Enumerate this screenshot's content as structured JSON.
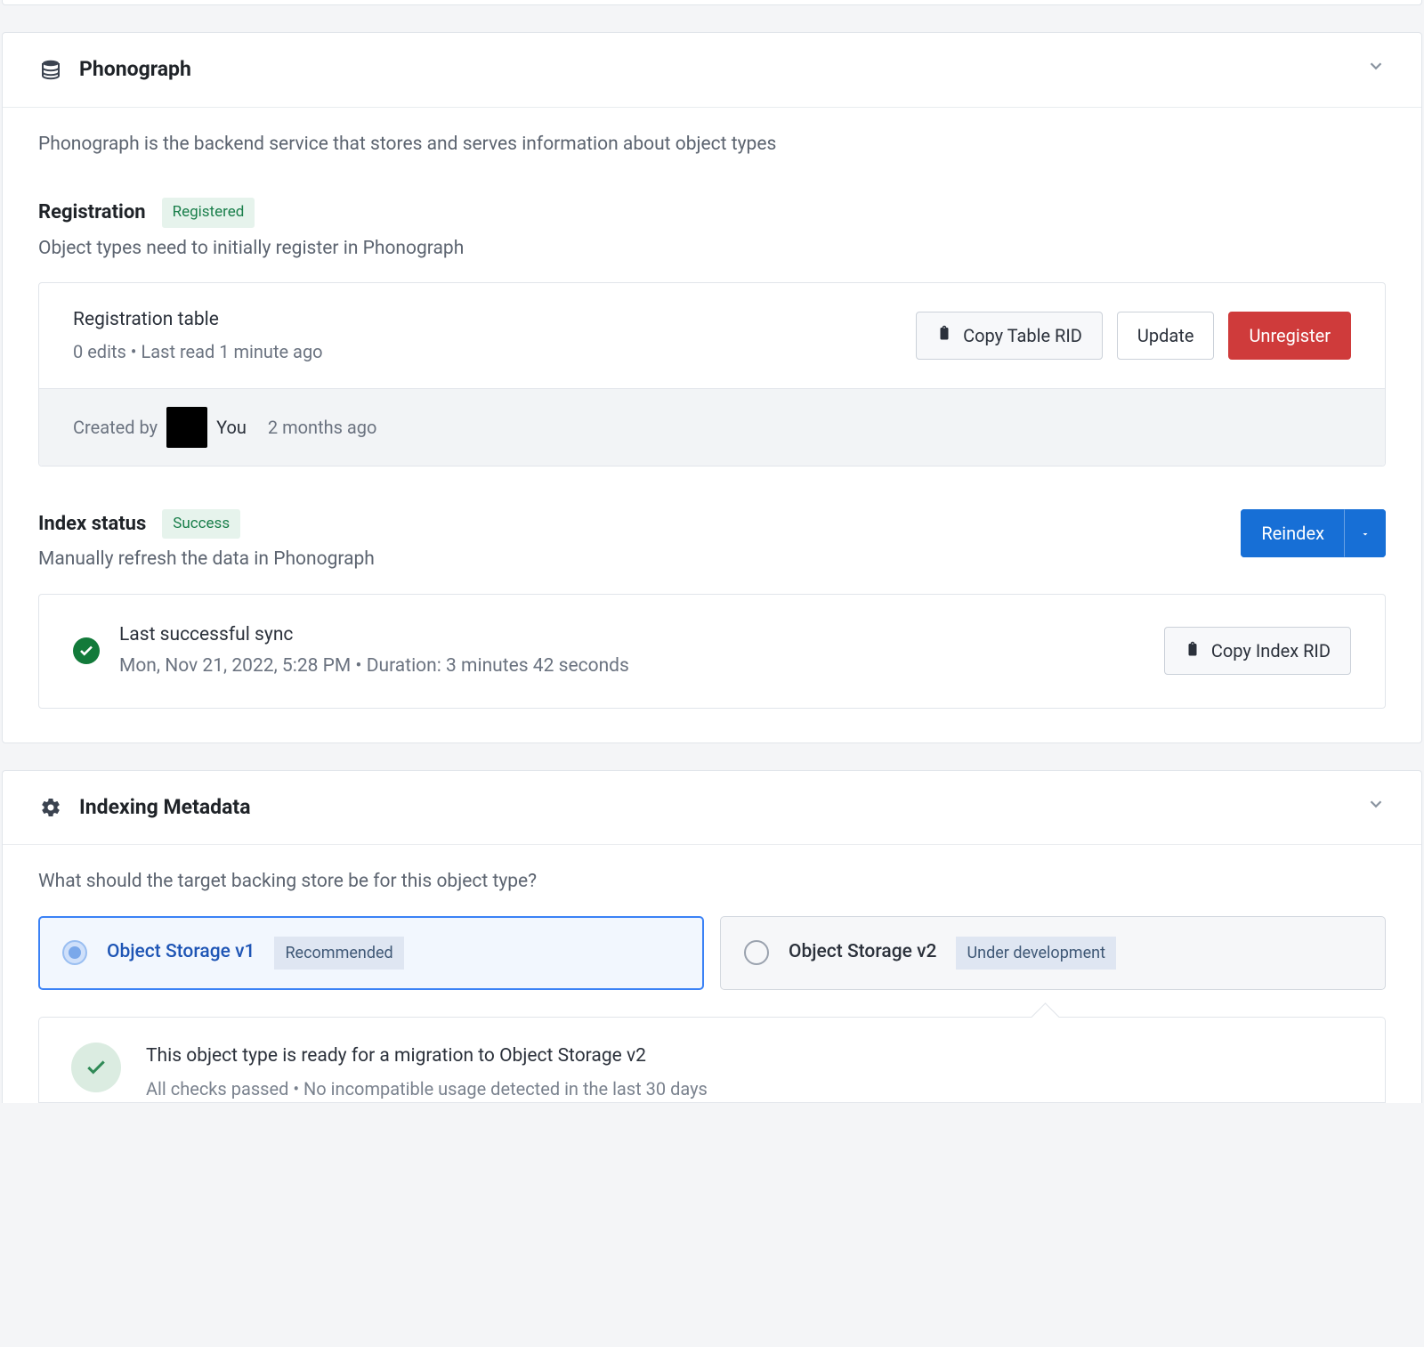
{
  "phonograph": {
    "title": "Phonograph",
    "description": "Phonograph is the backend service that stores and serves information about object types",
    "registration": {
      "heading": "Registration",
      "badge": "Registered",
      "sub": "Object types need to initially register in Phonograph",
      "table_title": "Registration table",
      "table_sub": "0 edits • Last read 1 minute ago",
      "copy_btn": "Copy Table RID",
      "update_btn": "Update",
      "unregister_btn": "Unregister",
      "created_by_label": "Created by",
      "created_by_name": "You",
      "created_when": "2 months ago"
    },
    "index": {
      "heading": "Index status",
      "badge": "Success",
      "sub": "Manually refresh the data in Phonograph",
      "reindex_btn": "Reindex",
      "sync_title": "Last successful sync",
      "sync_detail": "Mon, Nov 21, 2022, 5:28 PM • Duration: 3 minutes 42 seconds",
      "copy_btn": "Copy Index RID"
    }
  },
  "indexing": {
    "title": "Indexing Metadata",
    "question": "What should the target backing store be for this object type?",
    "options": [
      {
        "label": "Object Storage v1",
        "tag": "Recommended",
        "selected": true
      },
      {
        "label": "Object Storage v2",
        "tag": "Under development",
        "selected": false
      }
    ],
    "migration": {
      "title": "This object type is ready for a migration to Object Storage v2",
      "sub": "All checks passed • No incompatible usage detected in the last 30 days"
    }
  }
}
